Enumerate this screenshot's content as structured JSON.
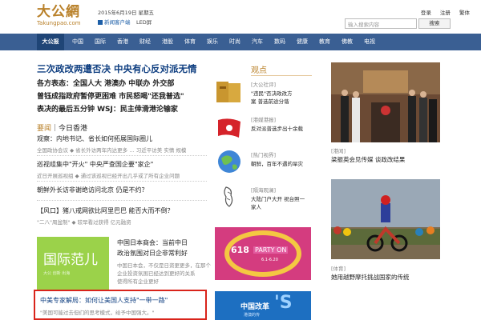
{
  "header": {
    "logo_cn": "大公網",
    "logo_en": "Takungpao.com",
    "date": "2015年6月19日 星期五",
    "client_link": "新闻客户端",
    "lrc_link": "LED屏",
    "links": [
      "登录",
      "注册",
      "繁体"
    ],
    "search_placeholder": "输入搜索内容",
    "search_button": "搜索"
  },
  "nav": {
    "items": [
      "大公报",
      "中国",
      "国际",
      "香港",
      "财经",
      "港股",
      "体育",
      "娱乐",
      "时尚",
      "汽车",
      "数码",
      "健康",
      "教育",
      "佛教",
      "电视"
    ],
    "active": "大公报"
  },
  "left": {
    "headline": "三次政改两遭否决 中央有心反对派无情",
    "leads": [
      "各方表态：全国人大 港澳办 中联办 外交部",
      "曾钰成指政府暂停更困难 市民怒喝\"还我普选\"",
      "表决的最后五分钟 WSJ：民主倖滑港沦输家"
    ],
    "section_label": "要闻",
    "section_rest": "｜今日香港",
    "items": [
      {
        "title": "观察：内地书记、省长如何拓展国际圈儿",
        "sub": "全国政协会议 ◆ 省长外访两年内达更多 … 习近平访美 实情 规模"
      },
      {
        "title": "巡视组集中\"开火\" 中央严查国企要\"家企\"",
        "sub": "近日开展巡视组 ◆ 通过该巡视已经开出几乎或了所有企业问题"
      },
      {
        "title": "朝鲜外长访非谢绝访问北京 仍是不约？",
        "sub": ""
      },
      {
        "title": "【风口】猪八戒网欲比阿里巴巴 能否大而不倒？",
        "sub": "\"二八\"周盆制\"  ◆ 较早看过获得 亿元融资"
      }
    ],
    "green_box": {
      "title": "国际范儿",
      "sub": "大公 创新 出海"
    },
    "green_items": [
      {
        "title": "中国日本商会：当前中日",
        "sub": ""
      },
      {
        "title": "政治氛围对日企非常利好",
        "sub": ""
      },
      {
        "title": "",
        "sub": "中国日本会，不仅是日资更更多，在那个"
      },
      {
        "title": "",
        "sub": "企业投资氛围已经达到更好的关系"
      },
      {
        "title": "",
        "sub": "使得所有企业更好"
      }
    ],
    "boxed": {
      "title": "中美专家解局：如何让美国人支持\"一带一路\"",
      "sub": "\"美国可能过去但们的思考模式，给予中国强大。\""
    }
  },
  "middle": {
    "heading": "观点",
    "items": [
      {
        "tag": "[大公社评]",
        "lines": [
          "\"违民\"否决政改方",
          "案 普选前途分谐"
        ]
      },
      {
        "tag": "[港媒港报]",
        "lines": [
          "反对派普选步出十余载"
        ]
      },
      {
        "tag": "[热门视界]",
        "lines": [
          "朝鲜，百年不遇的旱灾"
        ]
      },
      {
        "tag": "[隔海观澜]",
        "lines": [
          "大陆门户大开 祝台照一",
          "家人"
        ]
      }
    ],
    "ad_618": {
      "brand": "618",
      "party": "PARTY ON",
      "dates": "6.1-6.20"
    },
    "ad_reform": {
      "title": "中国改革",
      "mark": "'S",
      "sub": "港澳的传"
    }
  },
  "right": {
    "items": [
      {
        "tag": "[港闻]",
        "text": "梁振英会见传媒 谈政改结果"
      },
      {
        "tag": "[体育]",
        "text": "她用越野摩托挑战国家的传统"
      }
    ]
  },
  "colors": {
    "nav_bg": "#3a5f93",
    "nav_active": "#1f4576",
    "accent_gold": "#b9812a",
    "headline_blue": "#0e3e80",
    "highlight_red": "#d9241b"
  }
}
